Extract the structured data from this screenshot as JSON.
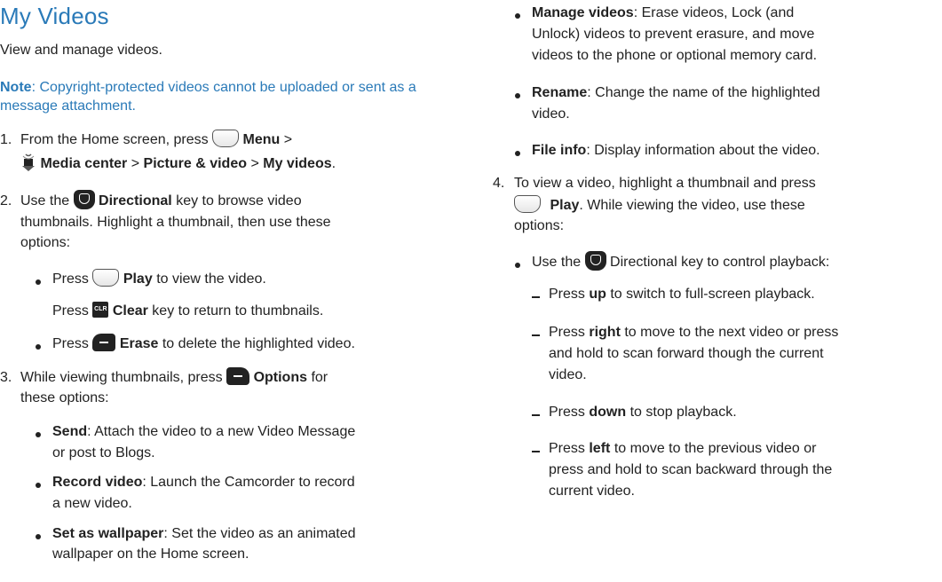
{
  "title": "My Videos",
  "intro": "View and manage videos.",
  "note": {
    "label": "Note",
    "text": ": Copyright-protected videos cannot be uploaded or sent as a message attachment."
  },
  "steps": {
    "s1": {
      "num": "1.",
      "a": "From the Home screen, press",
      "menu": "Menu",
      "sep1": ">",
      "media_center": "Media center",
      "sep2": ">",
      "picture_video": "Picture & video",
      "sep3": ">",
      "my_videos": "My videos",
      "end": "."
    },
    "s2": {
      "num": "2.",
      "a": "Use the",
      "directional": "Directional",
      "b": "key to browse video",
      "line2": "thumbnails. Highlight a thumbnail, then use these",
      "line3": "options:",
      "play_press": "Press",
      "play": "Play",
      "play_rest": "to view the video.",
      "clear_press": "Press",
      "clear": "Clear",
      "clear_rest": "key to return to thumbnails.",
      "erase_press": "Press",
      "erase": "Erase",
      "erase_rest": "to delete the highlighted video.",
      "clr_icon_text": "CLR"
    },
    "s3": {
      "num": "3.",
      "a": "While viewing thumbnails, press",
      "options": "Options",
      "b": "for",
      "line2": "these options:",
      "send": "Send",
      "send_text": ": Attach the video to a new Video Message",
      "send_line2": "or post to Blogs.",
      "record": "Record video",
      "record_text": ": Launch the Camcorder to record",
      "record_line2": "a new video.",
      "wallpaper": "Set as wallpaper",
      "wallpaper_text": ": Set the video as an animated",
      "wallpaper_line2": "wallpaper on the Home screen.",
      "manage": "Manage videos",
      "manage_text": ": Erase videos, Lock (and",
      "manage_line2": "Unlock) videos to prevent erasure, and move",
      "manage_line3": "videos to the phone or optional memory card.",
      "rename": "Rename",
      "rename_text": ": Change the name of the highlighted",
      "rename_line2": "video.",
      "fileinfo": "File info",
      "fileinfo_text": ": Display information about the video."
    },
    "s4": {
      "num": "4.",
      "a": "To view a video, highlight a thumbnail and press",
      "play": "Play",
      "b": ". While viewing the video, use these",
      "line3": "options:",
      "use_the": "Use the",
      "use_rest": "Directional key to control playback:",
      "up_press": "Press",
      "up": "up",
      "up_rest": "to switch to full-screen playback.",
      "right_press": "Press",
      "right": "right",
      "right_rest": "to move to the next video or press",
      "right_line2": "and hold to scan forward though the current",
      "right_line3": "video.",
      "down_press": "Press",
      "down": "down",
      "down_rest": "to stop playback.",
      "left_press": "Press",
      "left": "left",
      "left_rest": "to move to the previous video or",
      "left_line2": "press and hold to scan backward through the",
      "left_line3": "current video."
    }
  },
  "colors": {
    "accent": "#2a7ab8",
    "text": "#222222"
  },
  "icons": [
    "menu-key-icon",
    "media-center-icon",
    "directional-key-icon",
    "play-key-icon",
    "clear-key-icon",
    "erase-key-icon",
    "options-key-icon"
  ]
}
